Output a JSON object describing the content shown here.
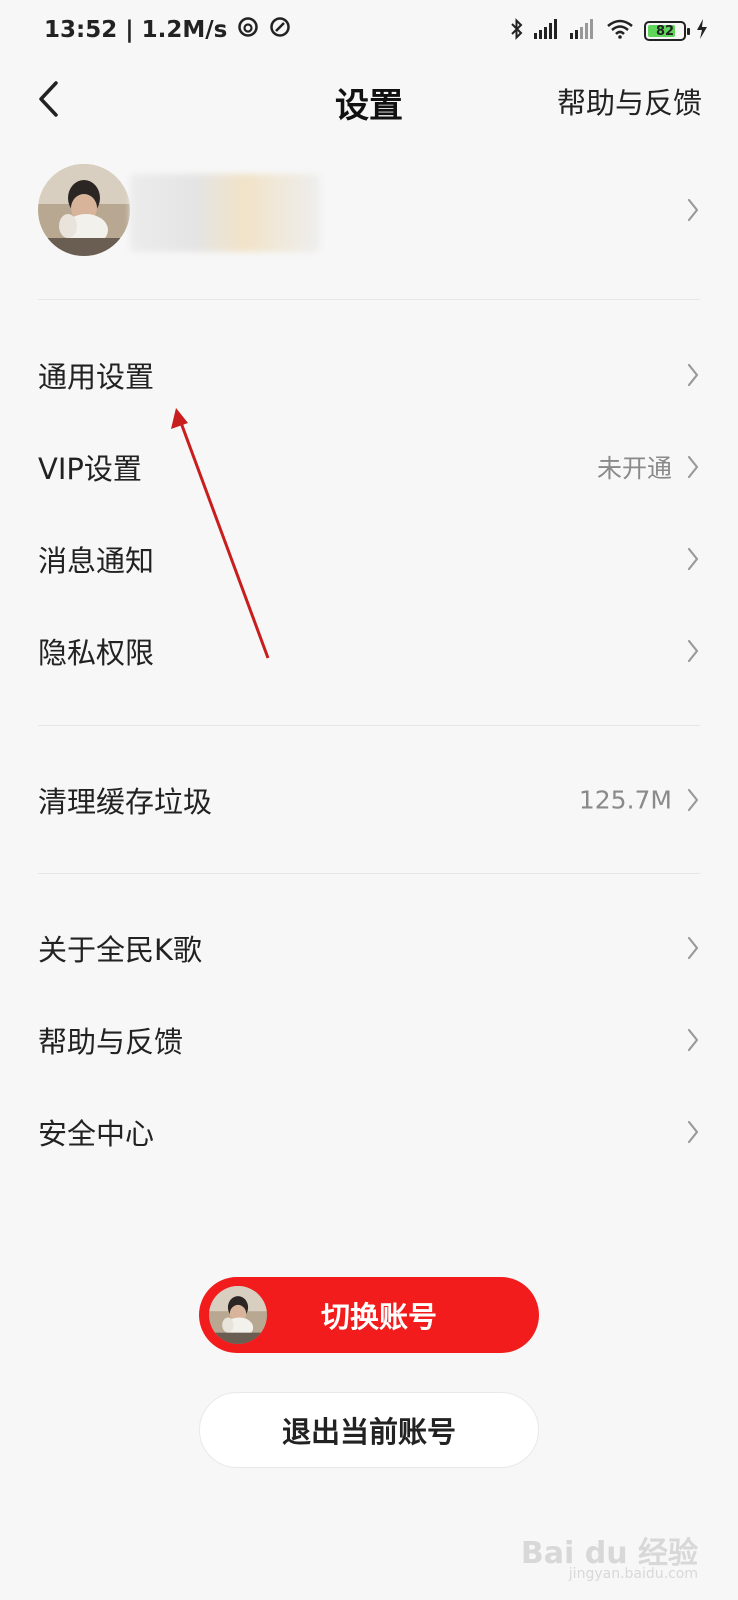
{
  "status_bar": {
    "time_speed": "13:52 | 1.2M/s",
    "battery_level": "82",
    "icons": [
      "bluetooth-icon",
      "signal-icon",
      "signal-icon",
      "wifi-icon",
      "battery-icon",
      "charging-icon"
    ]
  },
  "header": {
    "title": "设置",
    "help_link": "帮助与反馈"
  },
  "settings": {
    "group1": [
      {
        "label": "通用设置",
        "value": ""
      },
      {
        "label": "VIP设置",
        "value": "未开通"
      },
      {
        "label": "消息通知",
        "value": ""
      },
      {
        "label": "隐私权限",
        "value": ""
      }
    ],
    "group2": [
      {
        "label": "清理缓存垃圾",
        "value": "125.7M"
      }
    ],
    "group3": [
      {
        "label": "关于全民K歌",
        "value": ""
      },
      {
        "label": "帮助与反馈",
        "value": ""
      },
      {
        "label": "安全中心",
        "value": ""
      }
    ]
  },
  "actions": {
    "switch_account": "切换账号",
    "logout": "退出当前账号"
  },
  "watermark": {
    "brand": "Bai du 经验",
    "url": "jingyan.baidu.com"
  },
  "colors": {
    "accent": "#f21c1c",
    "annotation": "#c81e1e",
    "background": "#f7f7f7"
  }
}
